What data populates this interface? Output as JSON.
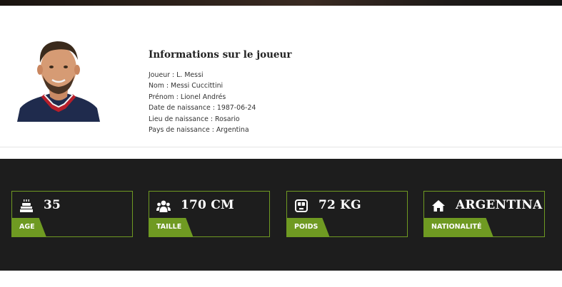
{
  "player_info": {
    "title": "Informations sur le joueur",
    "rows": [
      {
        "label": "Joueur",
        "value": "L. Messi"
      },
      {
        "label": "Nom",
        "value": "Messi Cuccittini"
      },
      {
        "label": "Prénom",
        "value": "Lionel Andrés"
      },
      {
        "label": "Date de naissance",
        "value": "1987-06-24"
      },
      {
        "label": "Lieu de naissance",
        "value": "Rosario"
      },
      {
        "label": "Pays de naissance",
        "value": "Argentina"
      }
    ],
    "photo_description_icon": "player-photo"
  },
  "stats": [
    {
      "icon": "birthday-cake-icon",
      "value": "35",
      "label": "AGE"
    },
    {
      "icon": "users-icon",
      "value": "170 CM",
      "label": "TAILLE"
    },
    {
      "icon": "scale-icon",
      "value": "72 KG",
      "label": "POIDS"
    },
    {
      "icon": "home-icon",
      "value": "ARGENTINA",
      "label": "NATIONALITÉ"
    }
  ],
  "colors": {
    "accent": "#6f9a22",
    "dark_bg": "#1d1d1d"
  }
}
